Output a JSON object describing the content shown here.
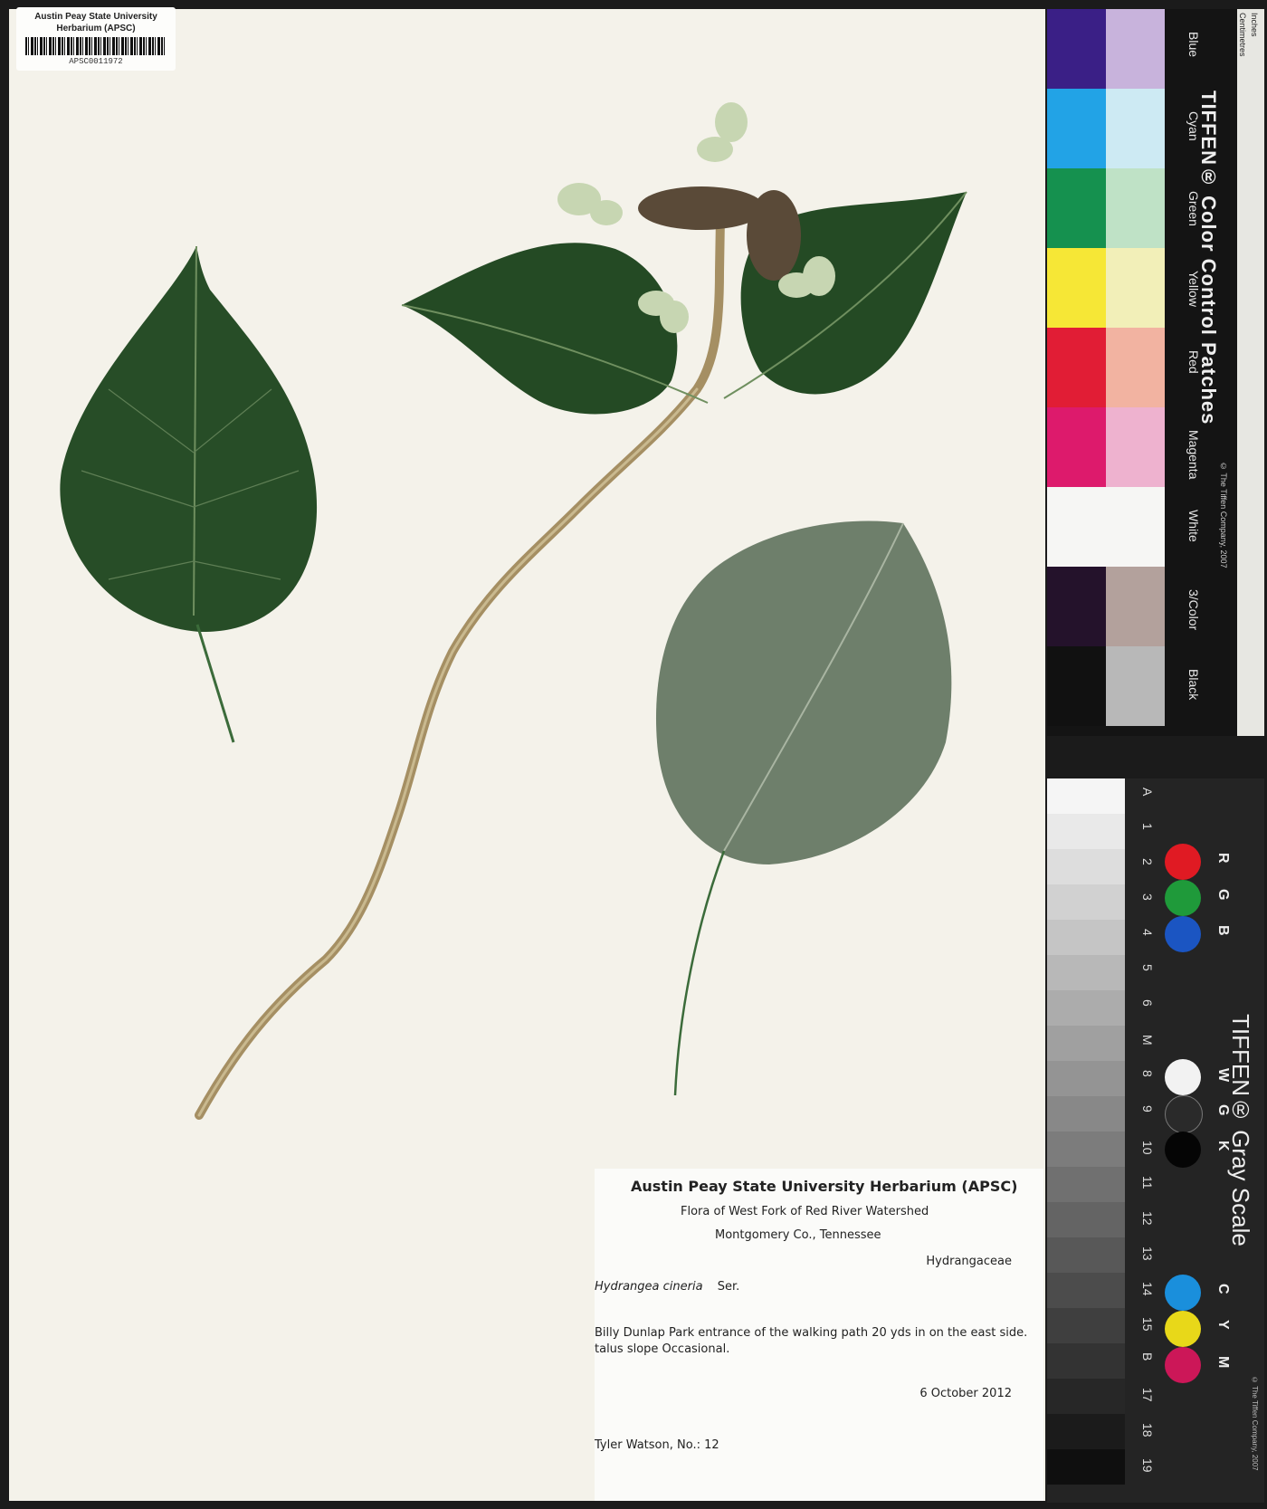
{
  "barcode_label": {
    "line1": "Austin Peay State University",
    "line2": "Herbarium (APSC)",
    "number": "APSC0011972"
  },
  "specimen_label": {
    "heading": "Austin Peay State University Herbarium (APSC)",
    "project": "Flora of West Fork of Red River Watershed",
    "county": "Montgomery Co.,  Tennessee",
    "family": "Hydrangaceae",
    "genus_species": "Hydrangea cineria",
    "author": "Ser.",
    "locality": "Billy Dunlap Park entrance of the walking path 20 yds in on the east side.",
    "habitat": "talus slope Occasional.",
    "date": "6 October 2012",
    "collector": "Tyler Watson, No.: 12"
  },
  "color_card": {
    "brand": "TIFFEN® Color Control Patches",
    "copyright": "© The Tiffen Company, 2007",
    "ruler_inches_label": "Inches",
    "ruler_cm_label": "Centimetres",
    "patches": [
      {
        "name": "Blue",
        "dark": "#3a1f86",
        "light": "#c8b3dc"
      },
      {
        "name": "Cyan",
        "dark": "#22a3e6",
        "light": "#cdeaf3"
      },
      {
        "name": "Green",
        "dark": "#15914f",
        "light": "#bfe2c6"
      },
      {
        "name": "Yellow",
        "dark": "#f6e736",
        "light": "#f2efb8"
      },
      {
        "name": "Red",
        "dark": "#e11d35",
        "light": "#f2b3a1"
      },
      {
        "name": "Magenta",
        "dark": "#dd1a6c",
        "light": "#eeb2cf"
      },
      {
        "name": "White",
        "dark": "#f6f6f4",
        "light": "#f6f6f4"
      },
      {
        "name": "3/Color",
        "dark": "#24122b",
        "light": "#b3a19c"
      },
      {
        "name": "Black",
        "dark": "#111111",
        "light": "#b8b8b8"
      }
    ]
  },
  "gray_scale": {
    "brand": "TIFFEN® Gray Scale",
    "copyright": "© The Tiffen Company, 2007",
    "steps": [
      "A",
      "1",
      "2",
      "3",
      "4",
      "5",
      "6",
      "M",
      "8",
      "9",
      "10",
      "11",
      "12",
      "13",
      "14",
      "15",
      "B",
      "17",
      "18",
      "19"
    ],
    "dots": [
      {
        "letter": "R",
        "color": "#e01a23"
      },
      {
        "letter": "G",
        "color": "#1f9a3a"
      },
      {
        "letter": "B",
        "color": "#1b55c2"
      },
      {
        "letter": "W",
        "color": "#f2f2f2"
      },
      {
        "letter": "G",
        "color": "#2a2a2a"
      },
      {
        "letter": "K",
        "color": "#050505"
      },
      {
        "letter": "C",
        "color": "#1a8fdc"
      },
      {
        "letter": "Y",
        "color": "#e8d819"
      },
      {
        "letter": "M",
        "color": "#cc1758"
      }
    ]
  }
}
